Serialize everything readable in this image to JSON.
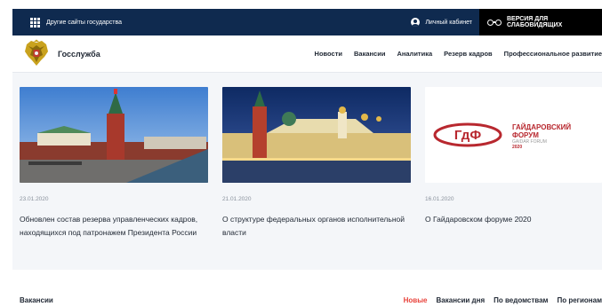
{
  "topbar": {
    "other_sites": "Другие сайты государства",
    "cabinet": "Личный кабинет",
    "accessibility": "ВЕРСИЯ ДЛЯ СЛАБОВИДЯЩИХ"
  },
  "header": {
    "brand": "Госслужба",
    "nav": [
      "Новости",
      "Вакансии",
      "Аналитика",
      "Резерв кадров",
      "Профессиональное развитие"
    ]
  },
  "news": [
    {
      "date": "23.01.2020",
      "title": "Обновлен состав резерва управленческих кадров, находящихся под патронажем Президента России"
    },
    {
      "date": "21.01.2020",
      "title": "О структуре федеральных органов исполнительной власти"
    },
    {
      "date": "16.01.2020",
      "title": "О Гайдаровском форуме 2020"
    }
  ],
  "forum_logo": {
    "mark": "ГдФ",
    "line1": "ГАЙДАРОВСКИЙ",
    "line2": "ФОРУМ",
    "line3": "GAIDAR FORUM",
    "line4": "2020"
  },
  "vacancies": {
    "title": "Вакансии",
    "tabs": [
      "Новые",
      "Вакансии дня",
      "По ведомствам",
      "По регионам"
    ],
    "active_tab": "Новые"
  },
  "colors": {
    "topbar": "#0f2a4f",
    "accent": "#e8413a",
    "news_bg": "#f4f6f9",
    "forum_red": "#b8282f"
  }
}
